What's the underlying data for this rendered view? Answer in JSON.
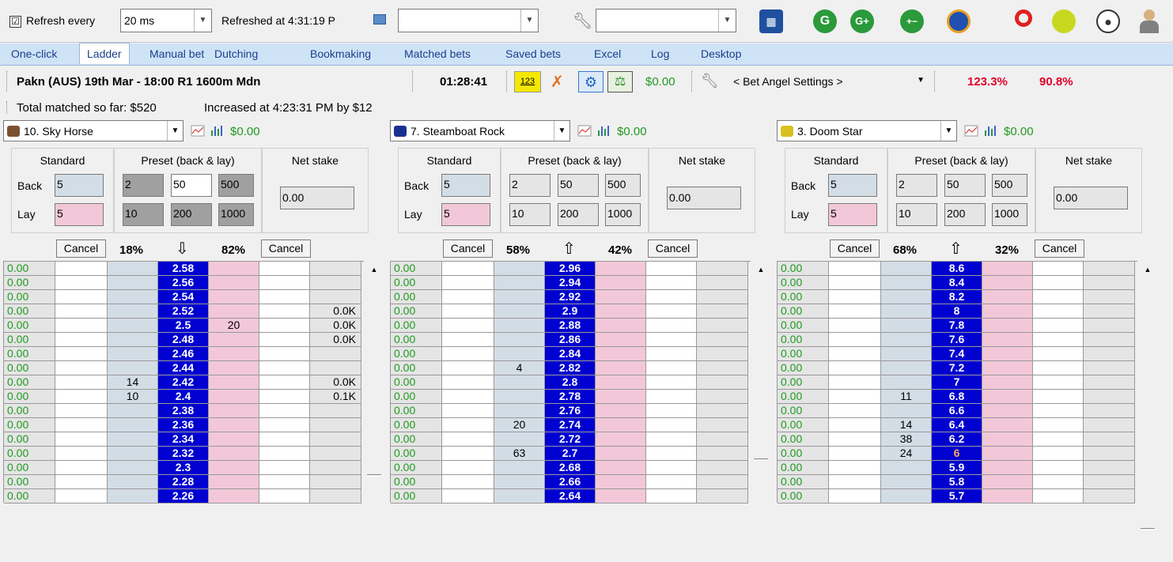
{
  "toolbar": {
    "refresh_checked": "☑",
    "refresh_label": "Refresh every",
    "refresh_interval": "20 ms",
    "refreshed_label": "Refreshed at 4:31:19 P",
    "combo1_value": "",
    "combo2_value": "",
    "icons": [
      "calculator-icon",
      "g-icon",
      "g-plus-icon",
      "counters-icon",
      "dial-icon",
      "pin-icon",
      "tennis-ball-icon",
      "soccer-ball-icon",
      "user-icon"
    ]
  },
  "tabs": [
    "One-click",
    "Ladder",
    "Manual bet",
    "Dutching",
    "Bookmaking",
    "Matched bets",
    "Saved bets",
    "Excel",
    "Log",
    "Desktop"
  ],
  "market": {
    "name": "Pakn (AUS) 19th Mar - 18:00 R1 1600m Mdn",
    "countdown": "01:28:41",
    "icon_123": "123",
    "pl": "$0.00",
    "settings": "< Bet Angel Settings >",
    "book_back": "123.3%",
    "book_lay": "90.8%",
    "total_matched": "Total matched so far: $520",
    "increased": "Increased at 4:23:31 PM by $12"
  },
  "colors": {
    "green": "#1e9a1e",
    "red": "#e0002a",
    "ladder_blue": "#0000d0",
    "lay_pink": "#f2c8d8",
    "back_blue": "#d3dde6"
  },
  "panels": [
    {
      "runner": "10. Sky Horse",
      "pl": "$0.00",
      "labels": {
        "standard": "Standard",
        "preset": "Preset (back & lay)",
        "net": "Net stake",
        "back": "Back",
        "lay": "Lay"
      },
      "back_stake": "5",
      "lay_stake": "5",
      "presets_top": [
        "2",
        "50",
        "500"
      ],
      "presets_bottom": [
        "10",
        "200",
        "1000"
      ],
      "net_stake": "0.00",
      "cancel": "Cancel",
      "back_pct": "18%",
      "lay_pct": "82%",
      "direction": "⇩",
      "rows": [
        [
          "0.00",
          "",
          "",
          "2.58",
          "",
          "",
          ""
        ],
        [
          "0.00",
          "",
          "",
          "2.56",
          "",
          "",
          ""
        ],
        [
          "0.00",
          "",
          "",
          "2.54",
          "",
          "",
          ""
        ],
        [
          "0.00",
          "",
          "",
          "2.52",
          "",
          "",
          "0.0K"
        ],
        [
          "0.00",
          "",
          "",
          "2.5",
          "20",
          "",
          "0.0K"
        ],
        [
          "0.00",
          "",
          "",
          "2.48",
          "",
          "",
          "0.0K"
        ],
        [
          "0.00",
          "",
          "",
          "2.46",
          "",
          "",
          ""
        ],
        [
          "0.00",
          "",
          "",
          "2.44",
          "",
          "",
          ""
        ],
        [
          "0.00",
          "",
          "14",
          "2.42",
          "",
          "",
          "0.0K"
        ],
        [
          "0.00",
          "",
          "10",
          "2.4",
          "",
          "",
          "0.1K"
        ],
        [
          "0.00",
          "",
          "",
          "2.38",
          "",
          "",
          ""
        ],
        [
          "0.00",
          "",
          "",
          "2.36",
          "",
          "",
          ""
        ],
        [
          "0.00",
          "",
          "",
          "2.34",
          "",
          "",
          ""
        ],
        [
          "0.00",
          "",
          "",
          "2.32",
          "",
          "",
          ""
        ],
        [
          "0.00",
          "",
          "",
          "2.3",
          "",
          "",
          ""
        ],
        [
          "0.00",
          "",
          "",
          "2.28",
          "",
          "",
          ""
        ],
        [
          "0.00",
          "",
          "",
          "2.26",
          "",
          "",
          ""
        ]
      ]
    },
    {
      "runner": "7. Steamboat Rock",
      "pl": "$0.00",
      "labels": {
        "standard": "Standard",
        "preset": "Preset (back & lay)",
        "net": "Net stake",
        "back": "Back",
        "lay": "Lay"
      },
      "back_stake": "5",
      "lay_stake": "5",
      "presets_top": [
        "2",
        "50",
        "500"
      ],
      "presets_bottom": [
        "10",
        "200",
        "1000"
      ],
      "net_stake": "0.00",
      "cancel": "Cancel",
      "back_pct": "58%",
      "lay_pct": "42%",
      "direction": "⇧",
      "rows": [
        [
          "0.00",
          "",
          "",
          "2.96",
          "",
          "",
          ""
        ],
        [
          "0.00",
          "",
          "",
          "2.94",
          "",
          "",
          ""
        ],
        [
          "0.00",
          "",
          "",
          "2.92",
          "",
          "",
          ""
        ],
        [
          "0.00",
          "",
          "",
          "2.9",
          "",
          "",
          ""
        ],
        [
          "0.00",
          "",
          "",
          "2.88",
          "",
          "",
          ""
        ],
        [
          "0.00",
          "",
          "",
          "2.86",
          "",
          "",
          ""
        ],
        [
          "0.00",
          "",
          "",
          "2.84",
          "",
          "",
          ""
        ],
        [
          "0.00",
          "",
          "4",
          "2.82",
          "",
          "",
          ""
        ],
        [
          "0.00",
          "",
          "",
          "2.8",
          "",
          "",
          ""
        ],
        [
          "0.00",
          "",
          "",
          "2.78",
          "",
          "",
          ""
        ],
        [
          "0.00",
          "",
          "",
          "2.76",
          "",
          "",
          ""
        ],
        [
          "0.00",
          "",
          "20",
          "2.74",
          "",
          "",
          ""
        ],
        [
          "0.00",
          "",
          "",
          "2.72",
          "",
          "",
          ""
        ],
        [
          "0.00",
          "",
          "63",
          "2.7",
          "",
          "",
          ""
        ],
        [
          "0.00",
          "",
          "",
          "2.68",
          "",
          "",
          ""
        ],
        [
          "0.00",
          "",
          "",
          "2.66",
          "",
          "",
          ""
        ],
        [
          "0.00",
          "",
          "",
          "2.64",
          "",
          "",
          ""
        ]
      ]
    },
    {
      "runner": "3. Doom Star",
      "pl": "$0.00",
      "labels": {
        "standard": "Standard",
        "preset": "Preset (back & lay)",
        "net": "Net stake",
        "back": "Back",
        "lay": "Lay"
      },
      "back_stake": "5",
      "lay_stake": "5",
      "presets_top": [
        "2",
        "50",
        "500"
      ],
      "presets_bottom": [
        "10",
        "200",
        "1000"
      ],
      "net_stake": "0.00",
      "cancel": "Cancel",
      "back_pct": "68%",
      "lay_pct": "32%",
      "direction": "⇧",
      "rows": [
        [
          "0.00",
          "",
          "",
          "8.6",
          "",
          "",
          ""
        ],
        [
          "0.00",
          "",
          "",
          "8.4",
          "",
          "",
          ""
        ],
        [
          "0.00",
          "",
          "",
          "8.2",
          "",
          "",
          ""
        ],
        [
          "0.00",
          "",
          "",
          "8",
          "",
          "",
          ""
        ],
        [
          "0.00",
          "",
          "",
          "7.8",
          "",
          "",
          ""
        ],
        [
          "0.00",
          "",
          "",
          "7.6",
          "",
          "",
          ""
        ],
        [
          "0.00",
          "",
          "",
          "7.4",
          "",
          "",
          ""
        ],
        [
          "0.00",
          "",
          "",
          "7.2",
          "",
          "",
          ""
        ],
        [
          "0.00",
          "",
          "",
          "7",
          "",
          "",
          ""
        ],
        [
          "0.00",
          "",
          "11",
          "6.8",
          "",
          "",
          ""
        ],
        [
          "0.00",
          "",
          "",
          "6.6",
          "",
          "",
          ""
        ],
        [
          "0.00",
          "",
          "14",
          "6.4",
          "",
          "",
          ""
        ],
        [
          "0.00",
          "",
          "38",
          "6.2",
          "",
          "",
          ""
        ],
        [
          "0.00",
          "",
          "24",
          "6",
          "",
          "",
          ""
        ],
        [
          "0.00",
          "",
          "",
          "5.9",
          "",
          "",
          ""
        ],
        [
          "0.00",
          "",
          "",
          "5.8",
          "",
          "",
          ""
        ],
        [
          "0.00",
          "",
          "",
          "5.7",
          "",
          "",
          ""
        ]
      ]
    }
  ]
}
